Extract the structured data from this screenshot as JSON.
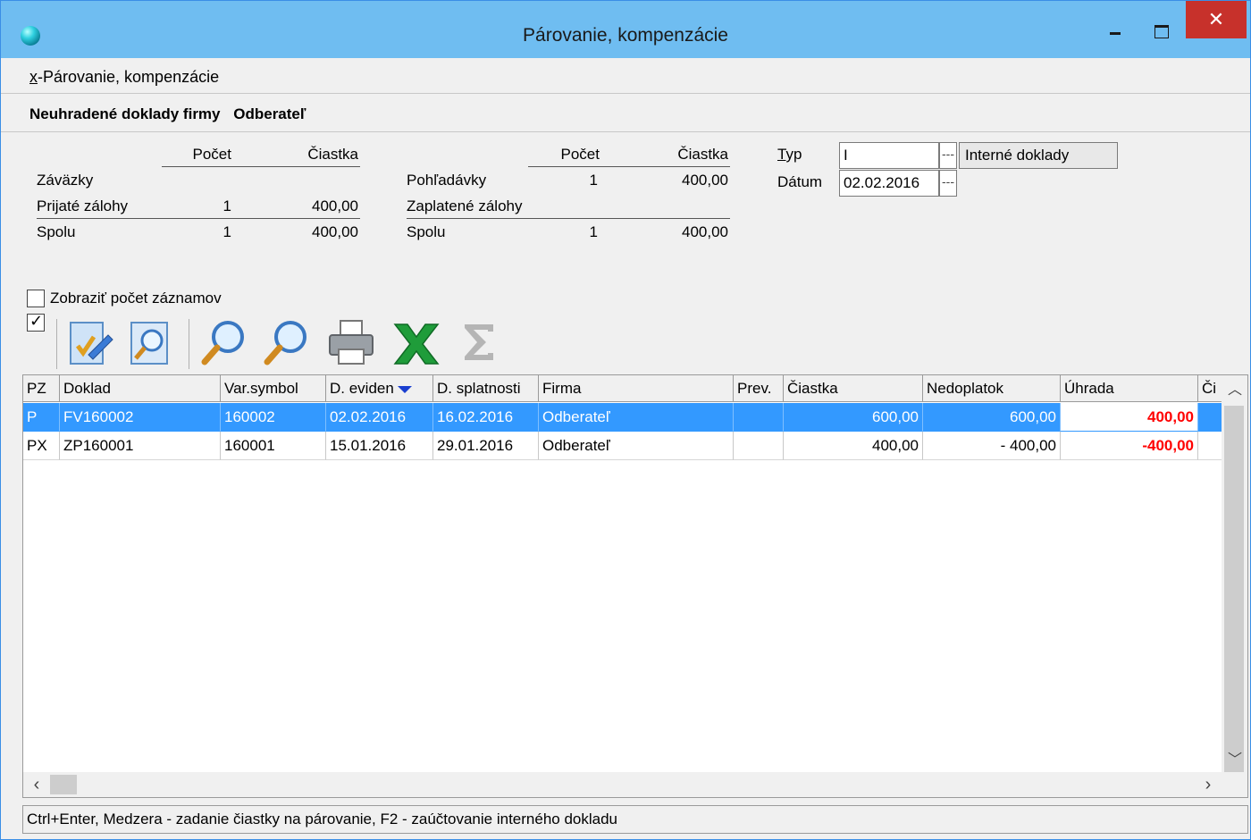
{
  "window": {
    "title": "Párovanie, kompenzácie",
    "close_glyph": "✕"
  },
  "menu": {
    "accel": "x",
    "rest": "-Párovanie, kompenzácie"
  },
  "heading": {
    "label": "Neuhradené doklady firmy",
    "firm": "Odberateľ"
  },
  "summary_left": {
    "col_count": "Počet",
    "col_amount": "Čiastka",
    "rows": [
      {
        "label": "Záväzky",
        "count": "",
        "amount": ""
      },
      {
        "label": "Prijaté zálohy",
        "count": "1",
        "amount": "400,00"
      }
    ],
    "total": {
      "label": "Spolu",
      "count": "1",
      "amount": "400,00"
    }
  },
  "summary_right": {
    "col_count": "Počet",
    "col_amount": "Čiastka",
    "rows": [
      {
        "label": "Pohľadávky",
        "count": "1",
        "amount": "400,00"
      },
      {
        "label": "Zaplatené zálohy",
        "count": "",
        "amount": ""
      }
    ],
    "total": {
      "label": "Spolu",
      "count": "1",
      "amount": "400,00"
    }
  },
  "fields": {
    "typ_accel": "T",
    "typ_rest": "yp",
    "typ_value": "I",
    "typ_name": "Interné doklady",
    "datum_label": "Dátum",
    "datum_value": "02.02.2016",
    "dots": "---"
  },
  "show_count_label": "Zobraziť počet záznamov",
  "grid": {
    "columns": [
      "PZ",
      "Doklad",
      "Var.symbol",
      "D. eviden",
      "D. splatnosti",
      "Firma",
      "Prev.",
      "Čiastka",
      "Nedoplatok",
      "Úhrada",
      "Či"
    ],
    "rows": [
      {
        "pz": "P",
        "doklad": "FV160002",
        "var": "160002",
        "d_evid": "02.02.2016",
        "d_spl": "16.02.2016",
        "firma": "Odberateľ",
        "prev": "",
        "ciastka": "600,00",
        "nedoplatok": "600,00",
        "uhrada": "400,00"
      },
      {
        "pz": "PX",
        "doklad": "ZP160001",
        "var": "160001",
        "d_evid": "15.01.2016",
        "d_spl": "29.01.2016",
        "firma": "Odberateľ",
        "prev": "",
        "ciastka": "400,00",
        "nedoplatok": "- 400,00",
        "uhrada": "-400,00"
      }
    ]
  },
  "status_text": "Ctrl+Enter, Medzera - zadanie čiastky na párovanie, F2 - zaúčtovanie interného dokladu",
  "colors": {
    "titlebar": "#6fbdf1",
    "selection": "#3399ff",
    "negative_payment": "#ff0000"
  }
}
